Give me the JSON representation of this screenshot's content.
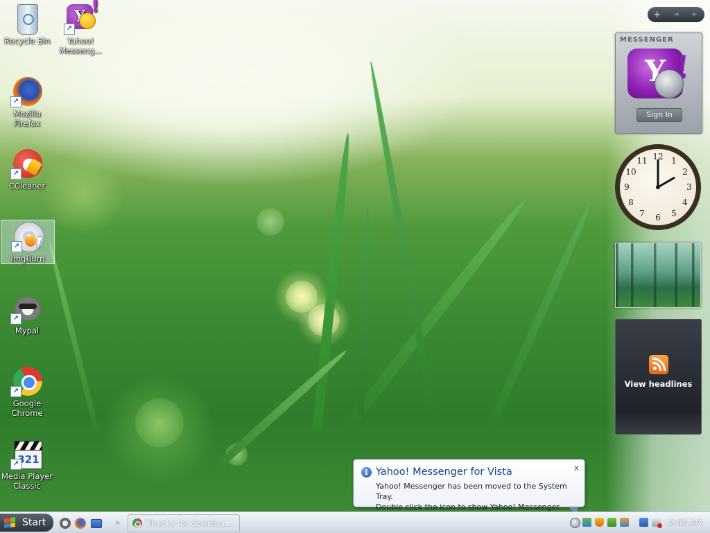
{
  "desktop_icons": [
    {
      "label": "Recycle Bin",
      "icon": "recycle-bin-icon"
    },
    {
      "label": "Yahoo! Messeng...",
      "icon": "yahoo-messenger-icon"
    },
    {
      "label": "Mozilla Firefox",
      "icon": "firefox-icon"
    },
    {
      "label": "CCleaner",
      "icon": "ccleaner-icon"
    },
    {
      "label": "ImgBurn",
      "icon": "imgburn-icon",
      "selected": true
    },
    {
      "label": "Mypal",
      "icon": "mypal-icon"
    },
    {
      "label": "Google Chrome",
      "icon": "chrome-icon"
    },
    {
      "label": "Media Player Classic",
      "icon": "media-player-classic-icon"
    }
  ],
  "sidebar": {
    "controls": [
      "+",
      "◄",
      "►"
    ],
    "messenger_gadget": {
      "header": "MESSENGER",
      "logo_text": "Y",
      "button": "Sign In"
    },
    "clock_gadget": {
      "hours": "2",
      "minutes": "0"
    },
    "feed_gadget": {
      "label": "View headlines"
    }
  },
  "balloon": {
    "title": "Yahoo! Messenger for Vista",
    "line1": "Yahoo! Messenger has been moved to the System Tray.",
    "line2": "Double click the icon to show Yahoo! Messenger.",
    "close": "x"
  },
  "taskbar": {
    "start_label": "Start",
    "quick_launch_more": "»",
    "task_label": "Thanks for downloa...",
    "clock": "2:00 AM"
  },
  "colors": {
    "balloon_title": "#1c3f8e",
    "yahoo_purple": "#8b1fb2",
    "rss_orange": "#e5671a"
  }
}
